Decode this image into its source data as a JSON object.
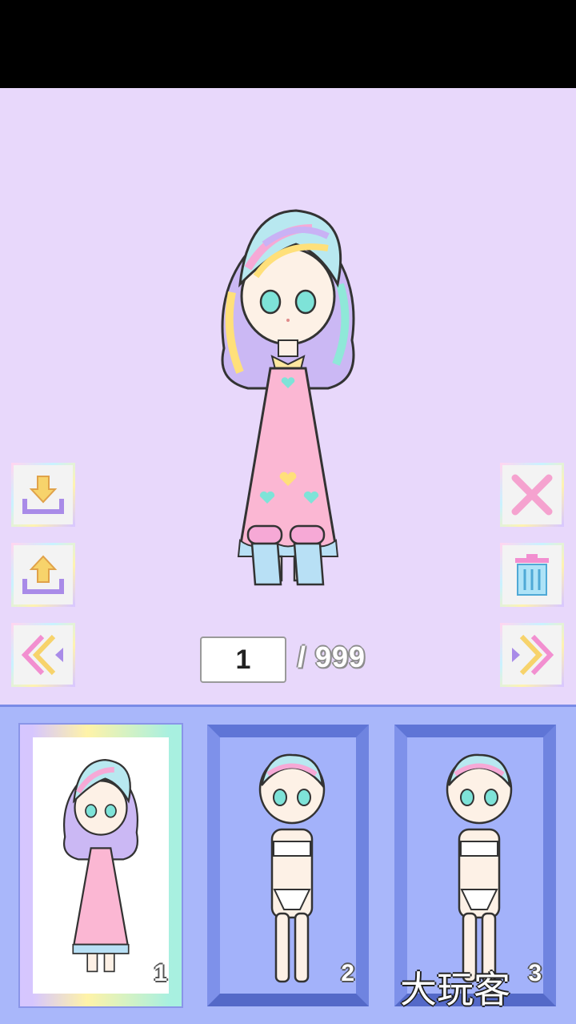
{
  "counter": {
    "current": "1",
    "total": "/ 999"
  },
  "slots": [
    {
      "number": "1",
      "state": "dressed"
    },
    {
      "number": "2",
      "state": "base"
    },
    {
      "number": "3",
      "state": "base"
    }
  ],
  "watermark": "大玩客",
  "buttons": {
    "left": [
      "download-icon",
      "upload-icon",
      "double-chevron-left-icon"
    ],
    "right": [
      "close-icon",
      "trash-icon",
      "double-chevron-right-icon"
    ]
  },
  "colors": {
    "stage_bg": "#e8d8fb",
    "tray_bg": "#a9b7fa",
    "accent_yellow": "#f7d36b",
    "accent_purple": "#a98be8",
    "accent_pink": "#f28fd0"
  }
}
